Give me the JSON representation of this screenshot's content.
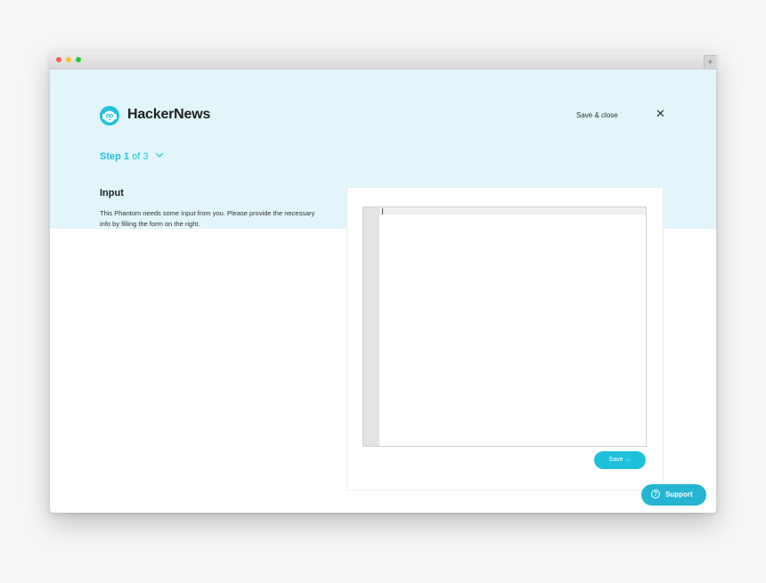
{
  "window": {
    "newtab_symbol": "+"
  },
  "header": {
    "app_name": "HackerNews",
    "save_close_label": "Save & close",
    "close_symbol": "✕"
  },
  "stepper": {
    "step_word": "Step",
    "current": "1",
    "of_text": "of 3"
  },
  "section": {
    "title": "Input",
    "description": "This Phantom needs some input from you. Please provide the necessary info by filling the form on the right."
  },
  "form": {
    "editor_value": "",
    "save_label": "Save →"
  },
  "support": {
    "icon_glyph": "?",
    "label": "Support"
  },
  "colors": {
    "accent": "#1fc0dc",
    "hero_background": "#e1f5fa",
    "traffic_red": "#fc5f57",
    "traffic_yellow": "#fdbc2e",
    "traffic_green": "#28c840"
  },
  "icons": {
    "logo": "phantom-head-icon",
    "step_toggle": "chevron-down-icon",
    "close": "close-icon",
    "support": "question-circle-icon"
  }
}
